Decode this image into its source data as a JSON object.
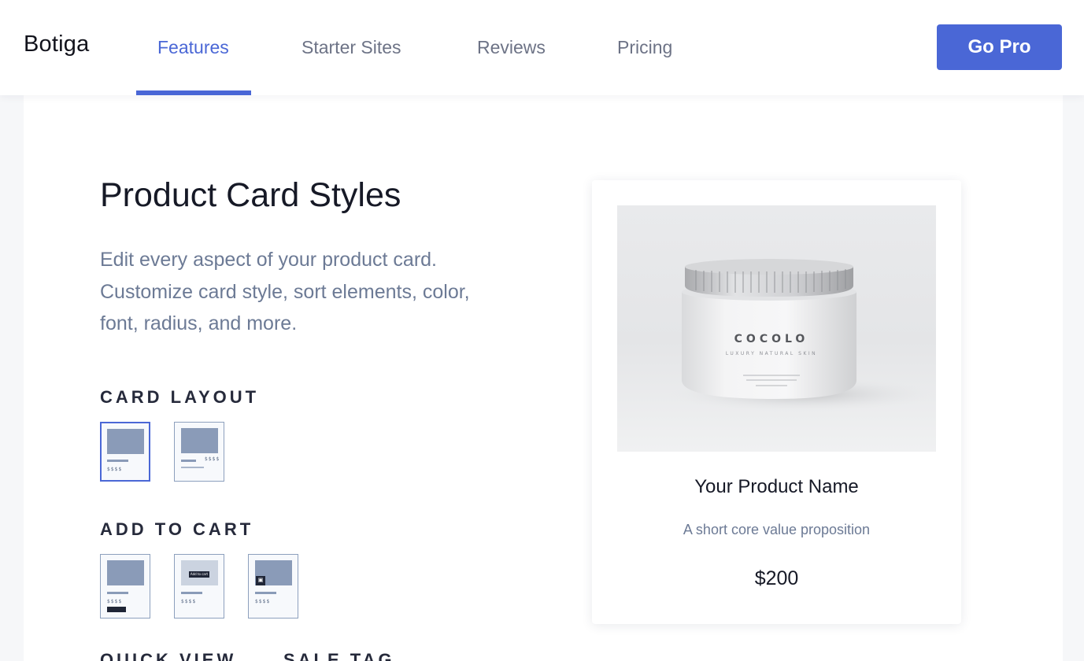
{
  "header": {
    "logo": "Botiga",
    "nav": [
      {
        "label": "Features",
        "active": true
      },
      {
        "label": "Starter Sites",
        "active": false
      },
      {
        "label": "Reviews",
        "active": false
      },
      {
        "label": "Pricing",
        "active": false
      }
    ],
    "cta": "Go Pro"
  },
  "section": {
    "title": "Product Card Styles",
    "description": "Edit every aspect of your product card. Customize card style, sort elements, color, font, radius, and more.",
    "groups": [
      {
        "label": "CARD LAYOUT",
        "options": [
          {
            "price": "$$$$",
            "selected": true
          },
          {
            "price": "$$$$",
            "selected": false
          }
        ]
      },
      {
        "label": "ADD TO CART",
        "options": [
          {
            "price": "$$$$"
          },
          {
            "price": "$$$$",
            "button": "Add to cart"
          },
          {
            "price": "$$$$"
          }
        ]
      },
      {
        "label": "QUICK VIEW"
      },
      {
        "label": "SALE TAG"
      }
    ]
  },
  "preview_card": {
    "jar_brand": "COCOLO",
    "jar_subtitle": "LUXURY NATURAL SKIN",
    "product_name": "Your Product Name",
    "tagline": "A short core value proposition",
    "price": "$200"
  },
  "colors": {
    "accent": "#4a67d6",
    "muted_text": "#6c7a95",
    "thumb_fill": "#8a9bb8"
  }
}
